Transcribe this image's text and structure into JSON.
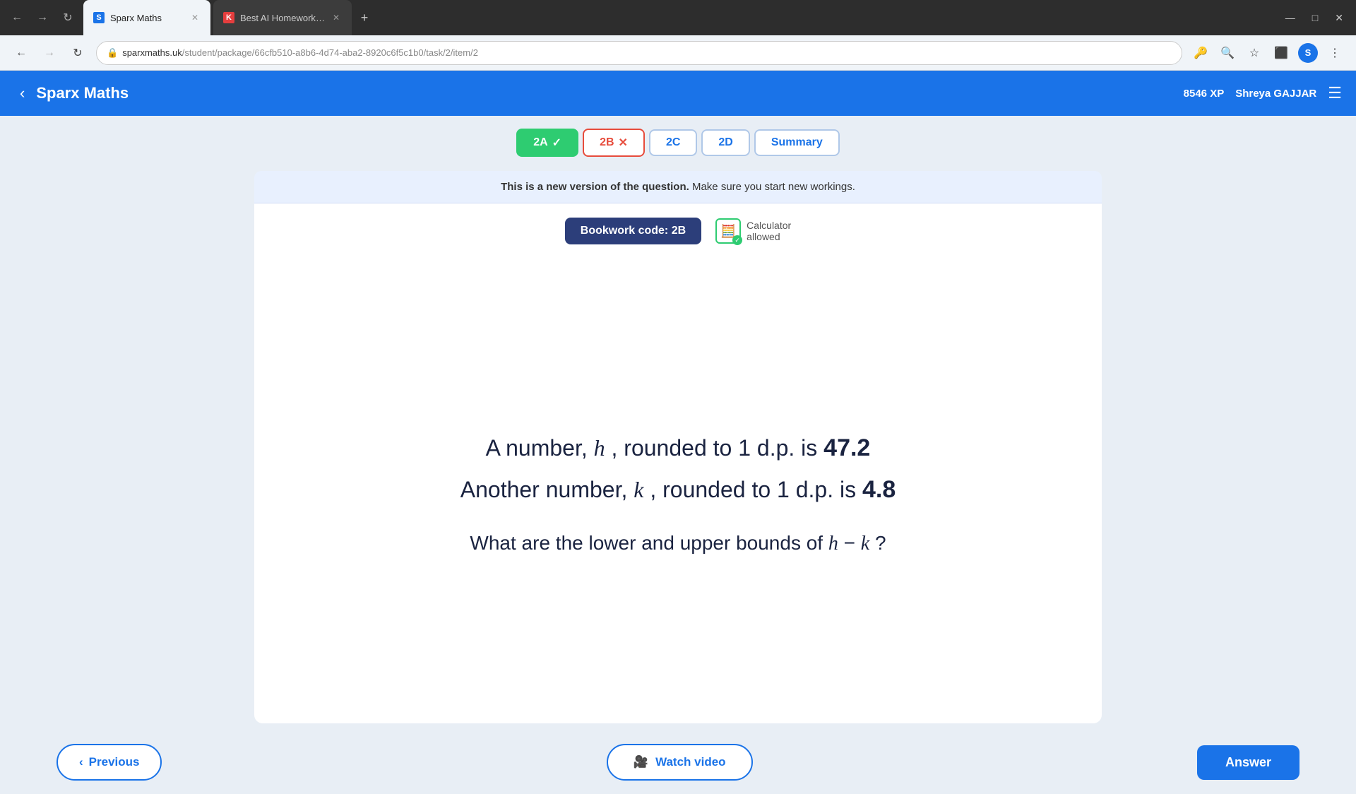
{
  "browser": {
    "tabs": [
      {
        "id": "tab1",
        "favicon_color": "#1a73e8",
        "favicon_letter": "S",
        "title": "Sparx Maths",
        "active": true
      },
      {
        "id": "tab2",
        "favicon_color": "#e53e3e",
        "favicon_letter": "K",
        "title": "Best AI Homework Helper for A",
        "active": false
      }
    ],
    "address": "sparxmaths.uk/student/package/66cfb510-a8b6-4d74-aba2-8920c6f5c1b0/task/2/item/2",
    "address_domain": "sparxmaths.uk",
    "address_path": "/student/package/66cfb510-a8b6-4d74-aba2-8920c6f5c1b0/task/2/item/2"
  },
  "app": {
    "title": "Sparx Maths",
    "xp": "8546 XP",
    "user": "Shreya GAJJAR"
  },
  "task_tabs": [
    {
      "id": "2A",
      "label": "2A",
      "status": "correct"
    },
    {
      "id": "2B",
      "label": "2B",
      "status": "wrong"
    },
    {
      "id": "2C",
      "label": "2C",
      "status": "normal"
    },
    {
      "id": "2D",
      "label": "2D",
      "status": "normal"
    },
    {
      "id": "summary",
      "label": "Summary",
      "status": "summary"
    }
  ],
  "question": {
    "banner_text_bold": "This is a new version of the question.",
    "banner_text": " Make sure you start new workings.",
    "bookwork_code": "Bookwork code: 2B",
    "calculator_label": "Calculator",
    "calculator_allowed_label": "allowed",
    "line1_pre": "A number, ",
    "line1_var": "h",
    "line1_post": ", rounded to 1 d.p. is ",
    "line1_num": "47.2",
    "line2_pre": "Another number, ",
    "line2_var": "k",
    "line2_post": ", rounded to 1 d.p. is ",
    "line2_num": "4.8",
    "question_pre": "What are the lower and upper bounds of ",
    "question_expr": "h − k",
    "question_post": "?"
  },
  "buttons": {
    "previous": "Previous",
    "watch_video": "Watch video",
    "answer": "Answer"
  }
}
